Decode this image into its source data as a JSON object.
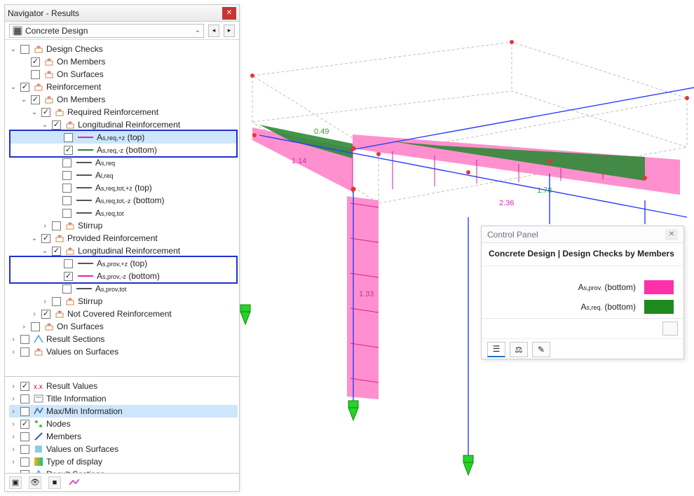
{
  "window": {
    "title": "Navigator - Results"
  },
  "category": {
    "label": "Concrete Design"
  },
  "tree": [
    {
      "d": 0,
      "c": "open",
      "chk": false,
      "icon": "gen",
      "t": "Design Checks"
    },
    {
      "d": 1,
      "c": "none",
      "chk": true,
      "icon": "gen",
      "t": "On Members"
    },
    {
      "d": 1,
      "c": "none",
      "chk": false,
      "icon": "gen",
      "t": "On Surfaces"
    },
    {
      "d": 0,
      "c": "open",
      "chk": true,
      "icon": "gen",
      "t": "Reinforcement"
    },
    {
      "d": 1,
      "c": "open",
      "chk": true,
      "icon": "gen",
      "t": "On Members"
    },
    {
      "d": 2,
      "c": "open",
      "chk": true,
      "icon": "gen",
      "t": "Required Reinforcement"
    },
    {
      "d": 3,
      "c": "open",
      "chk": true,
      "icon": "gen",
      "t": "Longitudinal Reinforcement"
    },
    {
      "d": 4,
      "c": "none",
      "chk": false,
      "line": "#e91fb3",
      "t": "A_s,req,+z (top)",
      "boxstart": true,
      "sel": true
    },
    {
      "d": 4,
      "c": "none",
      "chk": true,
      "line": "#1e8a1e",
      "t": "A_s,req,-z (bottom)",
      "boxend": true
    },
    {
      "d": 4,
      "c": "none",
      "chk": false,
      "line": "#555",
      "t": "A_s,req"
    },
    {
      "d": 4,
      "c": "none",
      "chk": false,
      "line": "#555",
      "t": "A_l,req"
    },
    {
      "d": 4,
      "c": "none",
      "chk": false,
      "line": "#555",
      "t": "A_s,req,tot,+z (top)"
    },
    {
      "d": 4,
      "c": "none",
      "chk": false,
      "line": "#555",
      "t": "A_s,req,tot,-z (bottom)"
    },
    {
      "d": 4,
      "c": "none",
      "chk": false,
      "line": "#555",
      "t": "A_s,req,tot"
    },
    {
      "d": 3,
      "c": "closed",
      "chk": false,
      "icon": "gen",
      "t": "Stirrup"
    },
    {
      "d": 2,
      "c": "open",
      "chk": true,
      "icon": "gen",
      "t": "Provided Reinforcement"
    },
    {
      "d": 3,
      "c": "open",
      "chk": true,
      "icon": "gen",
      "t": "Longitudinal Reinforcement"
    },
    {
      "d": 4,
      "c": "none",
      "chk": false,
      "line": "#555",
      "t": "A_s,prov,+z (top)",
      "boxstart": true
    },
    {
      "d": 4,
      "c": "none",
      "chk": true,
      "line": "#e91fb3",
      "t": "A_s,prov,-z (bottom)",
      "boxend": true
    },
    {
      "d": 4,
      "c": "none",
      "chk": false,
      "line": "#555",
      "t": "A_s,prov,tot"
    },
    {
      "d": 3,
      "c": "closed",
      "chk": false,
      "icon": "gen",
      "t": "Stirrup"
    },
    {
      "d": 2,
      "c": "closed",
      "chk": true,
      "icon": "gen",
      "t": "Not Covered Reinforcement"
    },
    {
      "d": 1,
      "c": "closed",
      "chk": false,
      "icon": "gen",
      "t": "On Surfaces"
    },
    {
      "d": 0,
      "c": "closed",
      "chk": false,
      "icon": "sect",
      "t": "Result Sections"
    },
    {
      "d": 0,
      "c": "closed",
      "chk": false,
      "icon": "gen",
      "t": "Values on Surfaces"
    }
  ],
  "tree2": [
    {
      "d": 0,
      "c": "closed",
      "chk": true,
      "icon": "rv",
      "t": "Result Values"
    },
    {
      "d": 0,
      "c": "closed",
      "chk": false,
      "icon": "ti",
      "t": "Title Information"
    },
    {
      "d": 0,
      "c": "closed",
      "chk": false,
      "icon": "mm",
      "t": "Max/Min Information",
      "sel": true
    },
    {
      "d": 0,
      "c": "closed",
      "chk": true,
      "icon": "nodes",
      "t": "Nodes"
    },
    {
      "d": 0,
      "c": "closed",
      "chk": false,
      "icon": "members",
      "t": "Members"
    },
    {
      "d": 0,
      "c": "closed",
      "chk": false,
      "icon": "vos",
      "t": "Values on Surfaces"
    },
    {
      "d": 0,
      "c": "closed",
      "chk": false,
      "icon": "tod",
      "t": "Type of display"
    },
    {
      "d": 0,
      "c": "closed",
      "chk": false,
      "icon": "sect",
      "t": "Result Sections"
    }
  ],
  "control_panel": {
    "title": "Control Panel",
    "subtitle": "Concrete Design | Design Checks by Members",
    "legend": [
      {
        "label": "A_s,prov. (bottom)",
        "color": "#ff2fa9"
      },
      {
        "label": "A_s,req. (bottom)",
        "color": "#1e8a1e"
      }
    ]
  },
  "viewport_labels": {
    "v1": "0.49",
    "v2": "1.14",
    "v3": "1.33",
    "v4": "1.78",
    "v5": "2.36"
  }
}
